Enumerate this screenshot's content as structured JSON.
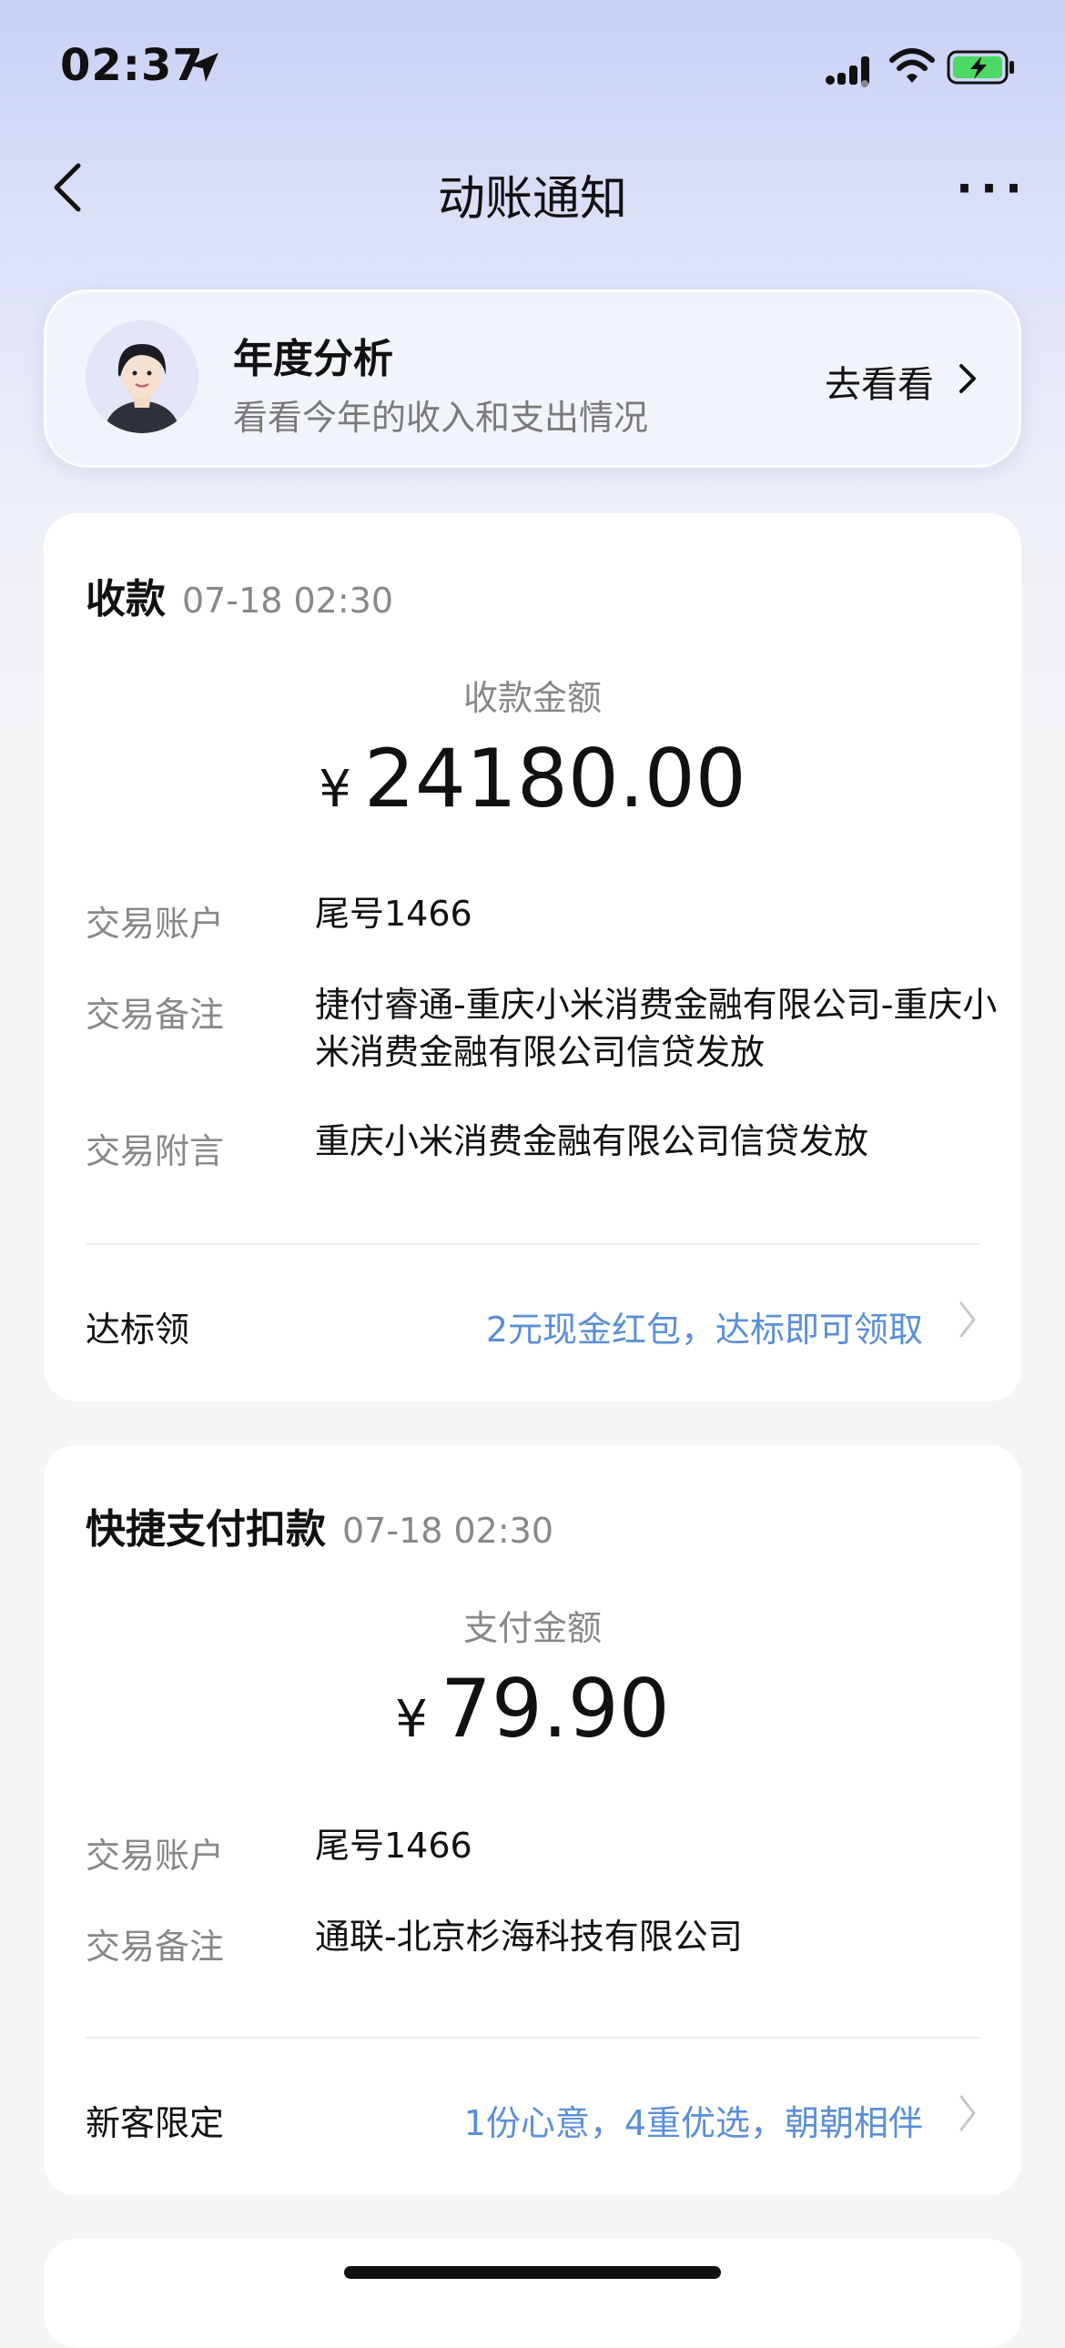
{
  "status": {
    "time": "02:37"
  },
  "nav": {
    "title": "动账通知",
    "more": "···"
  },
  "banner": {
    "title": "年度分析",
    "subtitle": "看看今年的收入和支出情况",
    "link": "去看看"
  },
  "cards": [
    {
      "type": "收款",
      "time": "07-18 02:30",
      "amount_label": "收款金额",
      "currency": "¥",
      "amount": "24180.00",
      "rows": [
        {
          "label": "交易账户",
          "value": "尾号1466"
        },
        {
          "label": "交易备注",
          "value": "捷付睿通-重庆小米消费金融有限公司-重庆小米消费金融有限公司信贷发放"
        },
        {
          "label": "交易附言",
          "value": "重庆小米消费金融有限公司信贷发放"
        }
      ],
      "promo_label": "达标领",
      "promo_text": "2元现金红包，达标即可领取"
    },
    {
      "type": "快捷支付扣款",
      "time": "07-18 02:30",
      "amount_label": "支付金额",
      "currency": "¥",
      "amount": "79.90",
      "rows": [
        {
          "label": "交易账户",
          "value": "尾号1466"
        },
        {
          "label": "交易备注",
          "value": "通联-北京杉海科技有限公司"
        }
      ],
      "promo_label": "新客限定",
      "promo_text": "1份心意，4重优选，朝朝相伴"
    }
  ],
  "colors": {
    "accent": "#5b8fd8",
    "label_gray": "#888888"
  },
  "icons": [
    "location-arrow-icon",
    "signal-icon",
    "wifi-icon",
    "battery-charging-icon",
    "back-chevron-icon",
    "chevron-right-icon"
  ]
}
